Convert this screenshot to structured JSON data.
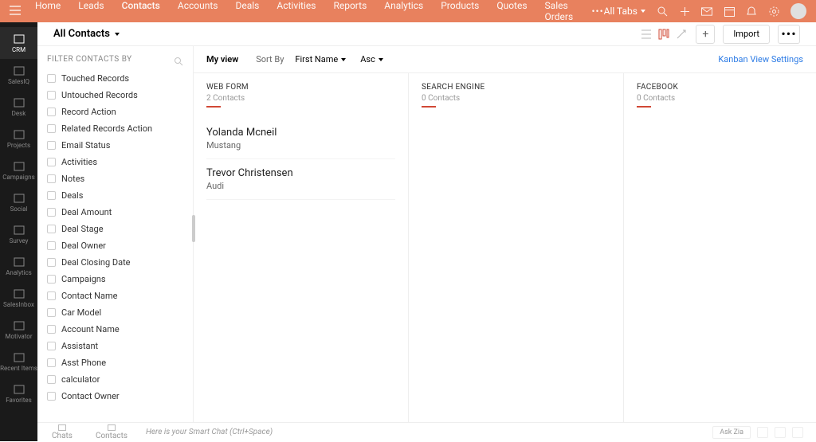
{
  "topnav": {
    "tabs": [
      "Home",
      "Leads",
      "Contacts",
      "Accounts",
      "Deals",
      "Activities",
      "Reports",
      "Analytics",
      "Products",
      "Quotes",
      "Sales Orders"
    ],
    "active_index": 2,
    "all_tabs": "All Tabs"
  },
  "leftrail": [
    {
      "label": "CRM",
      "active": true
    },
    {
      "label": "SalesIQ"
    },
    {
      "label": "Desk"
    },
    {
      "label": "Projects"
    },
    {
      "label": "Campaigns"
    },
    {
      "label": "Social"
    },
    {
      "label": "Survey"
    },
    {
      "label": "Analytics"
    },
    {
      "label": "SalesInbox"
    },
    {
      "label": "Motivator"
    },
    {
      "label": "Recent Items"
    },
    {
      "label": "Favorites"
    }
  ],
  "header": {
    "title": "All Contacts",
    "import": "Import"
  },
  "filter": {
    "title": "FILTER CONTACTS BY",
    "items": [
      "Touched Records",
      "Untouched Records",
      "Record Action",
      "Related Records Action",
      "Email Status",
      "Activities",
      "Notes",
      "Deals",
      "Deal Amount",
      "Deal Stage",
      "Deal Owner",
      "Deal Closing Date",
      "Campaigns",
      "Contact Name",
      "Car Model",
      "Account Name",
      "Assistant",
      "Asst Phone",
      "calculator",
      "Contact Owner"
    ]
  },
  "contentbar": {
    "myview": "My view",
    "sortby": "Sort By",
    "sortfield": "First Name",
    "direction": "Asc",
    "kanban_link": "Kanban View Settings"
  },
  "columns": [
    {
      "title": "WEB FORM",
      "count": "2 Contacts",
      "cards": [
        {
          "name": "Yolanda Mcneil",
          "sub": "Mustang"
        },
        {
          "name": "Trevor Christensen",
          "sub": "Audi"
        }
      ]
    },
    {
      "title": "SEARCH ENGINE",
      "count": "0 Contacts",
      "cards": []
    },
    {
      "title": "FACEBOOK",
      "count": "0 Contacts",
      "cards": []
    }
  ],
  "bottom": {
    "tabs": [
      {
        "label": "Chats"
      },
      {
        "label": "Contacts"
      }
    ],
    "chat_placeholder": "Here is your Smart Chat (Ctrl+Space)",
    "ask": "Ask Zia"
  }
}
